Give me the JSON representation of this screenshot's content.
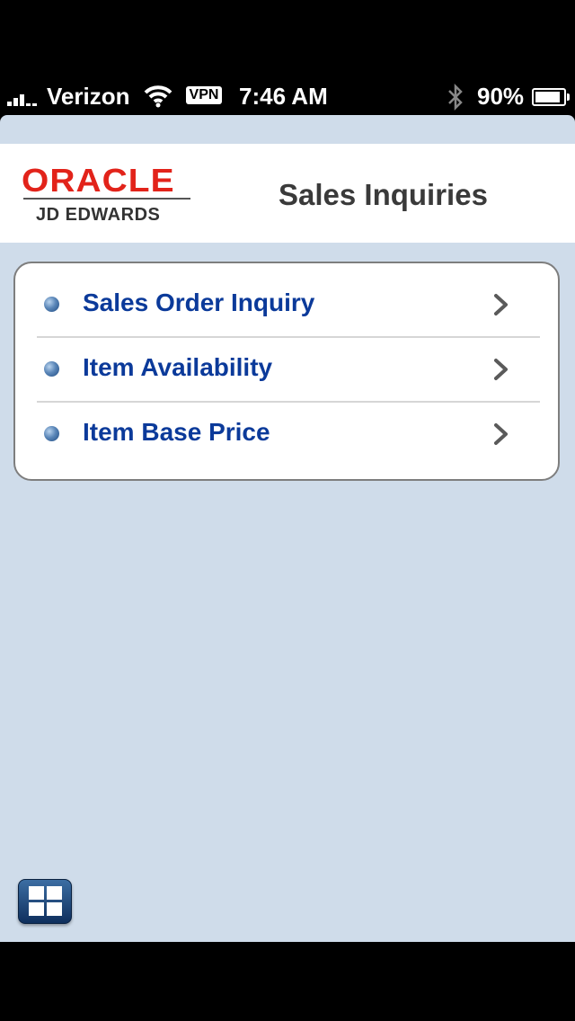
{
  "status_bar": {
    "carrier": "Verizon",
    "vpn": "VPN",
    "time": "7:46 AM",
    "battery_percent": "90%",
    "battery_level": 0.9,
    "icons": [
      "signal-icon",
      "wifi-icon",
      "vpn-icon",
      "bluetooth-icon",
      "battery-icon"
    ]
  },
  "header": {
    "logo_brand": "ORACLE",
    "logo_sub": "JD EDWARDS",
    "title": "Sales Inquiries"
  },
  "menu": {
    "items": [
      {
        "label": "Sales Order Inquiry",
        "icon": "bullet-icon",
        "chevron": "chevron-right-icon"
      },
      {
        "label": "Item Availability",
        "icon": "bullet-icon",
        "chevron": "chevron-right-icon"
      },
      {
        "label": "Item Base Price",
        "icon": "bullet-icon",
        "chevron": "chevron-right-icon"
      }
    ]
  },
  "footer": {
    "grid_button_icon": "grid-icon"
  },
  "colors": {
    "background": "#cfdcea",
    "menu_text": "#0b3a9a",
    "oracle_red": "#e2231a",
    "title_text": "#3a3a3a"
  }
}
